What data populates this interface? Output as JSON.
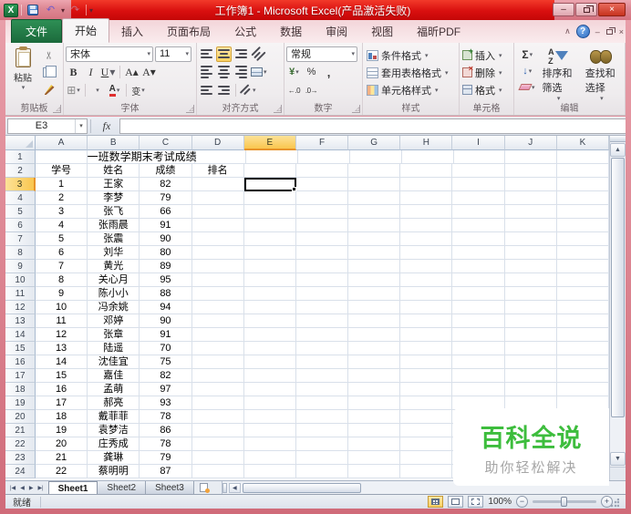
{
  "window": {
    "title": "工作簿1 - Microsoft Excel(产品激活失败)"
  },
  "icons": {
    "excel_logo": "X",
    "undo": "↶",
    "redo": "↷",
    "customize_qat": "▾",
    "minimize": "–",
    "close": "×",
    "collapse_ribbon": "∧",
    "help": "?",
    "dropdown": "▾",
    "scissors": "✂",
    "bold": "B",
    "italic": "I",
    "underline": "U",
    "grow_font": "A▴",
    "shrink_font": "A▾",
    "borders": "⊞",
    "font_color": "A",
    "fill_color_letter": "",
    "currency": "¥",
    "percent": "%",
    "comma": ",",
    "inc_decimal": "←.0",
    "dec_decimal": ".0→",
    "sum": "Σ",
    "fill_down": "↓",
    "fx": "fx",
    "nav_first": "|◀",
    "nav_prev": "◀",
    "nav_next": "▶",
    "nav_last": "▶|",
    "scroll_up": "▲",
    "scroll_down": "▼",
    "scroll_left": "◀",
    "zoom_out": "−",
    "zoom_in": "+"
  },
  "ribbon": {
    "tabs": [
      {
        "name": "file",
        "label": "文件",
        "type": "file"
      },
      {
        "name": "home",
        "label": "开始",
        "active": true
      },
      {
        "name": "insert",
        "label": "插入"
      },
      {
        "name": "page-layout",
        "label": "页面布局"
      },
      {
        "name": "formulas",
        "label": "公式"
      },
      {
        "name": "data",
        "label": "数据"
      },
      {
        "name": "review",
        "label": "审阅"
      },
      {
        "name": "view",
        "label": "视图"
      },
      {
        "name": "foxit-pdf",
        "label": "福昕PDF"
      }
    ],
    "clipboard": {
      "label": "剪贴板",
      "paste": "粘贴"
    },
    "font": {
      "label": "字体",
      "font_name": "宋体",
      "font_size": "11",
      "phonetic": "变"
    },
    "alignment": {
      "label": "对齐方式"
    },
    "number": {
      "label": "数字",
      "format": "常规"
    },
    "styles": {
      "label": "样式",
      "conditional": "条件格式",
      "format_table": "套用表格格式",
      "cell_styles": "单元格样式"
    },
    "cells": {
      "label": "单元格",
      "insert": "插入",
      "delete": "删除",
      "format": "格式"
    },
    "editing": {
      "label": "编辑",
      "sort": "排序和筛选",
      "find": "查找和选择"
    }
  },
  "formula_bar": {
    "name_box": "E3",
    "formula": ""
  },
  "sheet": {
    "columns": [
      "A",
      "B",
      "C",
      "D",
      "E",
      "F",
      "G",
      "H",
      "I",
      "J",
      "K"
    ],
    "row_count": 24,
    "active_cell": "E3",
    "title_text": "一班数学期末考试成绩",
    "header_labels": [
      "学号",
      "姓名",
      "成绩",
      "排名"
    ],
    "students": [
      [
        1,
        "王家",
        82
      ],
      [
        2,
        "李梦",
        79
      ],
      [
        3,
        "张飞",
        66
      ],
      [
        4,
        "张雨晨",
        91
      ],
      [
        5,
        "张震",
        90
      ],
      [
        6,
        "刘华",
        80
      ],
      [
        7,
        "黄光",
        89
      ],
      [
        8,
        "关心月",
        95
      ],
      [
        9,
        "陈小小",
        88
      ],
      [
        10,
        "冯余姚",
        94
      ],
      [
        11,
        "邓婷",
        90
      ],
      [
        12,
        "张章",
        91
      ],
      [
        13,
        "陆遥",
        70
      ],
      [
        14,
        "沈佳宜",
        75
      ],
      [
        15,
        "嘉佳",
        82
      ],
      [
        16,
        "孟萌",
        97
      ],
      [
        17,
        "郝亮",
        93
      ],
      [
        18,
        "戴菲菲",
        78
      ],
      [
        19,
        "袁梦洁",
        86
      ],
      [
        20,
        "庄秀成",
        78
      ],
      [
        21,
        "龚琳",
        79
      ],
      [
        22,
        "蔡明明",
        87
      ]
    ]
  },
  "sheet_tabs": {
    "items": [
      "Sheet1",
      "Sheet2",
      "Sheet3"
    ],
    "active": "Sheet1"
  },
  "status_bar": {
    "mode": "就绪",
    "zoom_level": "100%"
  },
  "watermark": {
    "title": "百科全说",
    "subtitle": "助你轻松解决",
    "accent": "#3dbd3d"
  }
}
